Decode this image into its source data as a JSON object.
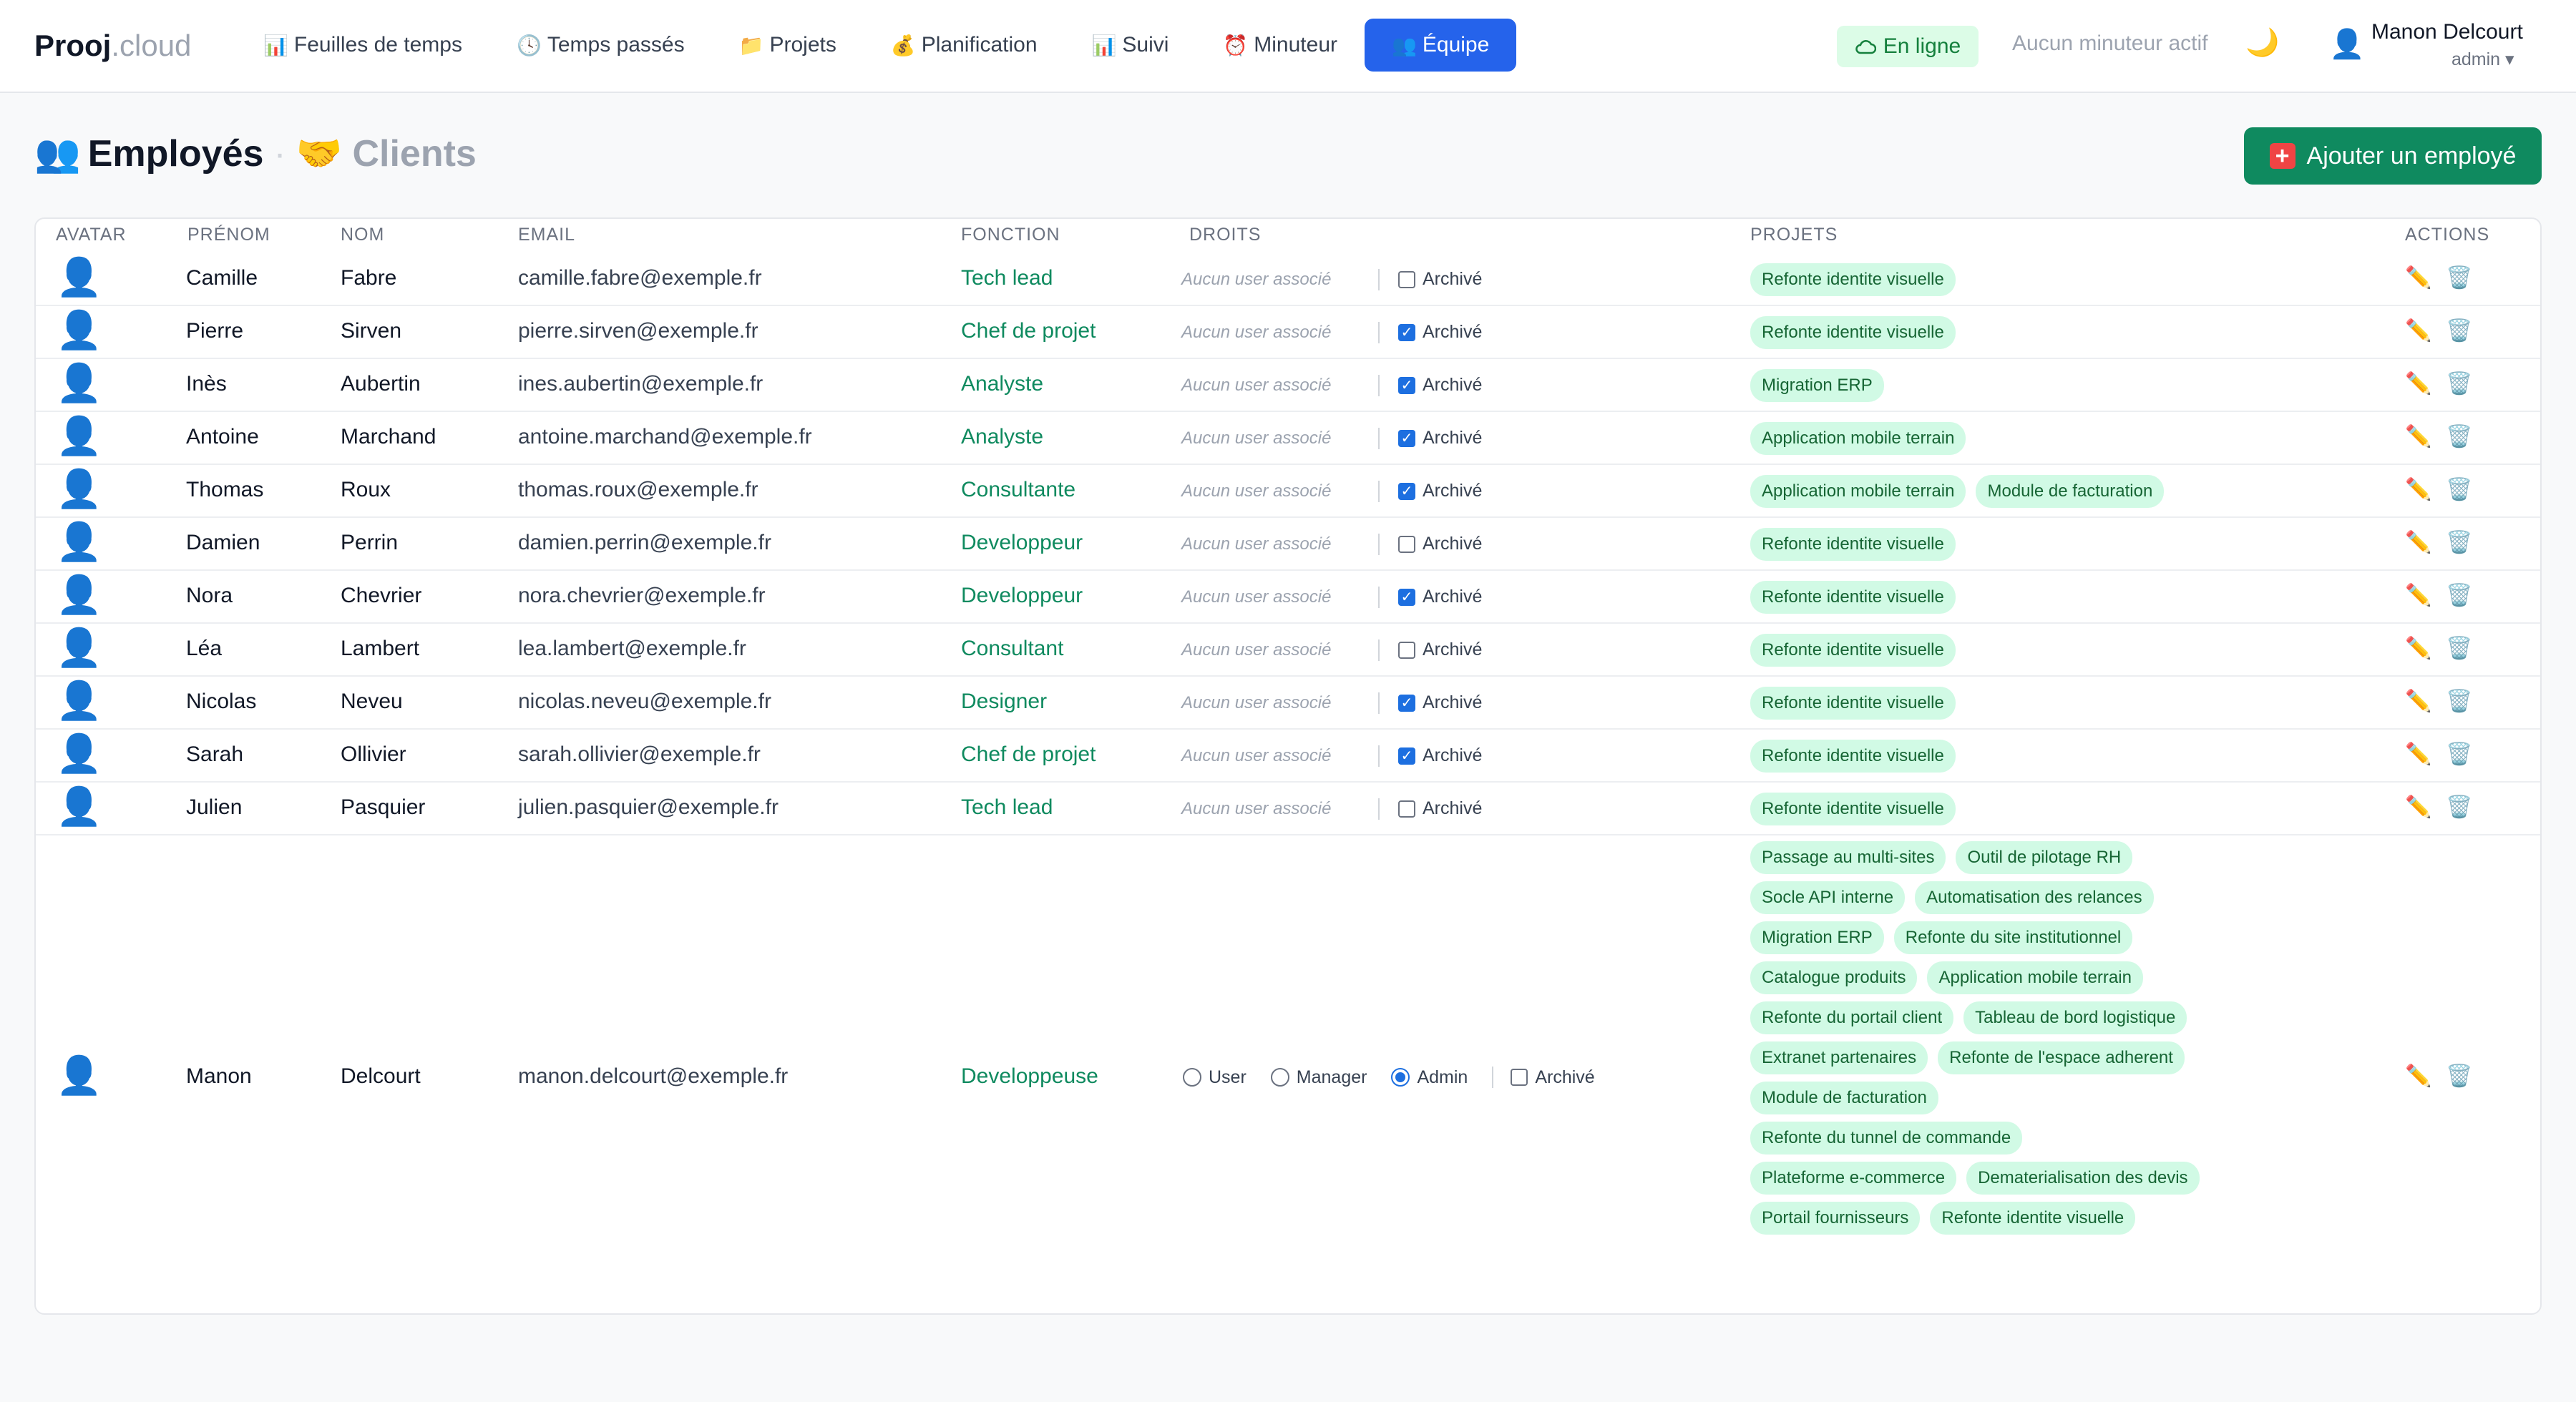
{
  "brand": {
    "name": "Prooj",
    "suffix": ".cloud"
  },
  "nav": [
    {
      "icon": "📊",
      "label": "Feuilles de temps"
    },
    {
      "icon": "🕓",
      "label": "Temps passés"
    },
    {
      "icon": "📁",
      "label": "Projets"
    },
    {
      "icon": "💰",
      "label": "Planification"
    },
    {
      "icon": "📊",
      "label": "Suivi"
    },
    {
      "icon": "⏰",
      "label": "Minuteur"
    },
    {
      "icon": "👥",
      "label": "Équipe",
      "active": true
    }
  ],
  "status": {
    "label": "En ligne",
    "icon": "cloud-icon"
  },
  "timer": {
    "label": "Aucun minuteur actif"
  },
  "user": {
    "name": "Manon Delcourt",
    "role": "admin ▾"
  },
  "header": {
    "tab_employees": "Employés",
    "separator": "·",
    "tab_clients": "Clients",
    "add_button": "Ajouter un employé",
    "icon_employees": "👥",
    "icon_clients": "🤝"
  },
  "columns": [
    "AVATAR",
    "PRÉNOM",
    "NOM",
    "EMAIL",
    "FONCTION",
    "DROITS",
    "PROJETS",
    "ACTIONS"
  ],
  "labels": {
    "no_user": "Aucun user associé",
    "archived": "Archivé",
    "roles": [
      "User",
      "Manager",
      "Admin"
    ]
  },
  "rows": [
    {
      "prenom": "Camille",
      "nom": "Fabre",
      "email": "camille.fabre@exemple.fr",
      "fonction": "Tech lead",
      "archived": false,
      "projects": [
        "Refonte identite visuelle"
      ]
    },
    {
      "prenom": "Pierre",
      "nom": "Sirven",
      "email": "pierre.sirven@exemple.fr",
      "fonction": "Chef de projet",
      "archived": true,
      "projects": [
        "Refonte identite visuelle"
      ]
    },
    {
      "prenom": "Inès",
      "nom": "Aubertin",
      "email": "ines.aubertin@exemple.fr",
      "fonction": "Analyste",
      "archived": true,
      "projects": [
        "Migration ERP"
      ]
    },
    {
      "prenom": "Antoine",
      "nom": "Marchand",
      "email": "antoine.marchand@exemple.fr",
      "fonction": "Analyste",
      "archived": true,
      "projects": [
        "Application mobile terrain"
      ]
    },
    {
      "prenom": "Thomas",
      "nom": "Roux",
      "email": "thomas.roux@exemple.fr",
      "fonction": "Consultante",
      "archived": true,
      "projects": [
        "Application mobile terrain",
        "Module de facturation"
      ]
    },
    {
      "prenom": "Damien",
      "nom": "Perrin",
      "email": "damien.perrin@exemple.fr",
      "fonction": "Developpeur",
      "archived": false,
      "projects": [
        "Refonte identite visuelle"
      ]
    },
    {
      "prenom": "Nora",
      "nom": "Chevrier",
      "email": "nora.chevrier@exemple.fr",
      "fonction": "Developpeur",
      "archived": true,
      "projects": [
        "Refonte identite visuelle"
      ]
    },
    {
      "prenom": "Léa",
      "nom": "Lambert",
      "email": "lea.lambert@exemple.fr",
      "fonction": "Consultant",
      "archived": false,
      "projects": [
        "Refonte identite visuelle"
      ]
    },
    {
      "prenom": "Nicolas",
      "nom": "Neveu",
      "email": "nicolas.neveu@exemple.fr",
      "fonction": "Designer",
      "archived": true,
      "projects": [
        "Refonte identite visuelle"
      ]
    },
    {
      "prenom": "Sarah",
      "nom": "Ollivier",
      "email": "sarah.ollivier@exemple.fr",
      "fonction": "Chef de projet",
      "archived": true,
      "projects": [
        "Refonte identite visuelle"
      ]
    },
    {
      "prenom": "Julien",
      "nom": "Pasquier",
      "email": "julien.pasquier@exemple.fr",
      "fonction": "Tech lead",
      "archived": false,
      "projects": [
        "Refonte identite visuelle"
      ]
    },
    {
      "prenom": "Manon",
      "nom": "Delcourt",
      "email": "manon.delcourt@exemple.fr",
      "fonction": "Developpeuse",
      "archived": false,
      "role": "Admin",
      "projects": [
        "Passage au multi-sites",
        "Outil de pilotage RH",
        "Socle API interne",
        "Automatisation des relances",
        "Migration ERP",
        "Refonte du site institutionnel",
        "Catalogue produits",
        "Application mobile terrain",
        "Refonte du portail client",
        "Tableau de bord logistique",
        "Extranet partenaires",
        "Refonte de l'espace adherent",
        "Module de facturation",
        "Refonte du tunnel de commande",
        "Plateforme e-commerce",
        "Dematerialisation des devis",
        "Portail fournisseurs",
        "Refonte identite visuelle"
      ]
    }
  ],
  "colors": {
    "accent": "#2563eb",
    "success": "#0f8a5f",
    "tag_bg": "#d1fae5",
    "tag_text": "#166534"
  }
}
